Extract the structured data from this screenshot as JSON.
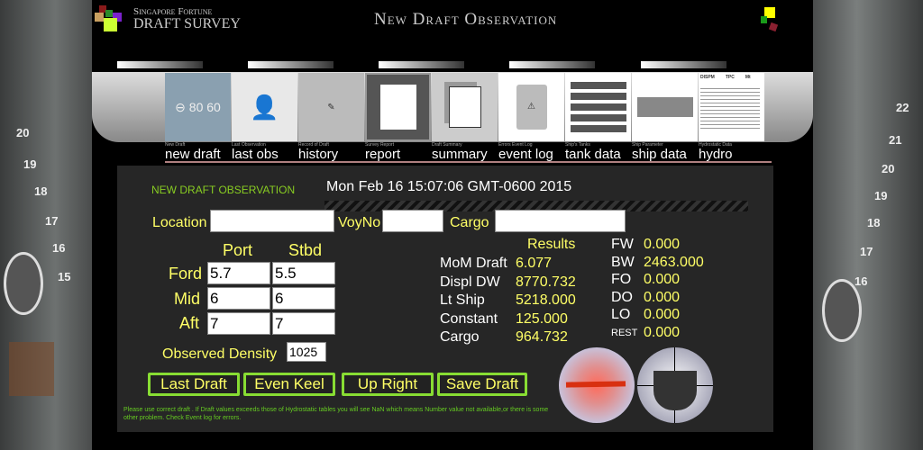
{
  "header": {
    "logo_line1": "Singapore Fortune",
    "logo_line2": "Draft Survey",
    "title": "New Draft Observation"
  },
  "nav": [
    {
      "sub": "New Draft",
      "label": "new draft"
    },
    {
      "sub": "Last Observation",
      "label": "last obs"
    },
    {
      "sub": "Record of Draft",
      "label": "history"
    },
    {
      "sub": "Survey Report",
      "label": "report"
    },
    {
      "sub": "Draft Summary",
      "label": "summary"
    },
    {
      "sub": "Errors Event Log",
      "label": "event log"
    },
    {
      "sub": "Ship's Tanks",
      "label": "tank data"
    },
    {
      "sub": "Ship Parameter",
      "label": "ship data"
    },
    {
      "sub": "Hydrostatic Data",
      "label": "hydro"
    }
  ],
  "hydro_tile": {
    "headers": [
      "DISPM",
      "TPC",
      "Mt"
    ]
  },
  "hull_marks_left": [
    "20",
    "19",
    "18",
    "17",
    "16",
    "15"
  ],
  "hull_marks_right": [
    "22",
    "21",
    "20",
    "19",
    "18",
    "17",
    "16"
  ],
  "panel": {
    "heading": "NEW DRAFT OBSERVATION",
    "datetime": "Mon Feb 16 15:07:06 GMT-0600 2015",
    "location_label": "Location",
    "location_value": "",
    "voyno_label": "VoyNo",
    "voyno_value": "",
    "cargo_label": "Cargo",
    "cargo_value": "",
    "port_label": "Port",
    "stbd_label": "Stbd",
    "rows": [
      {
        "label": "Ford",
        "port": "5.7",
        "stbd": "5.5"
      },
      {
        "label": "Mid",
        "port": "6",
        "stbd": "6"
      },
      {
        "label": "Aft",
        "port": "7",
        "stbd": "7"
      }
    ],
    "density_label": "Observed Density",
    "density_value": "1025",
    "results_title": "Results",
    "results": [
      {
        "label": "MoM Draft",
        "value": "6.077"
      },
      {
        "label": "Displ DW",
        "value": "8770.732"
      },
      {
        "label": "Lt Ship",
        "value": "5218.000"
      },
      {
        "label": "Constant",
        "value": "125.000"
      },
      {
        "label": "Cargo",
        "value": "964.732"
      }
    ],
    "tanks": [
      {
        "label": "FW",
        "value": "0.000"
      },
      {
        "label": "BW",
        "value": "2463.000"
      },
      {
        "label": "FO",
        "value": "0.000"
      },
      {
        "label": "DO",
        "value": "0.000"
      },
      {
        "label": "LO",
        "value": "0.000"
      },
      {
        "label": "REST",
        "value": "0.000"
      }
    ],
    "buttons": {
      "last_draft": "Last Draft",
      "even_keel": "Even Keel",
      "up_right": "Up Right",
      "save_draft": "Save Draft"
    },
    "note": "Please use correct draft . If Draft values exceeds those of Hydrostatic tables you will see NaN which means Number value not available,or there is some other problem. Check Event log for errors."
  }
}
